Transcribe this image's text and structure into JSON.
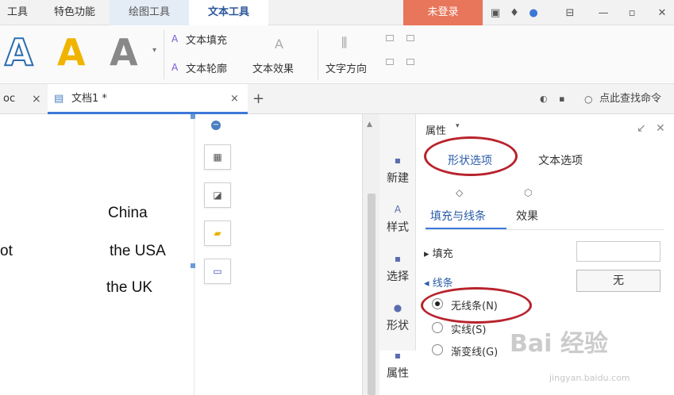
{
  "menubar": {
    "tabs": [
      "工具",
      "特色功能",
      "绘图工具",
      "文本工具"
    ],
    "login": "未登录"
  },
  "ribbon": {
    "style_letter": "A",
    "text_fill": "文本填充",
    "text_outline": "文本轮廓",
    "text_effect": "文本效果",
    "text_direction": "文字方向"
  },
  "doctabs": {
    "prev_tab": "oc",
    "active_tab": "文档1 *",
    "search": "点此查找命令"
  },
  "document": {
    "lines": [
      "China",
      "the USA",
      "the UK"
    ],
    "left_fragment": "ot"
  },
  "sidebar": {
    "items": [
      "新建",
      "样式",
      "选择",
      "形状",
      "属性"
    ]
  },
  "panel": {
    "title": "属性",
    "tabs": [
      "形状选项",
      "文本选项"
    ],
    "subtabs": [
      "填充与线条",
      "效果"
    ],
    "fill_label": "填充",
    "line_label": "线条",
    "line_value": "无",
    "options": [
      {
        "label": "无线条(N)",
        "selected": true
      },
      {
        "label": "实线(S)",
        "selected": false
      },
      {
        "label": "渐变线(G)",
        "selected": false
      }
    ]
  },
  "watermark": {
    "text": "Bai 经验",
    "sub": "jingyan.baidu.com"
  }
}
